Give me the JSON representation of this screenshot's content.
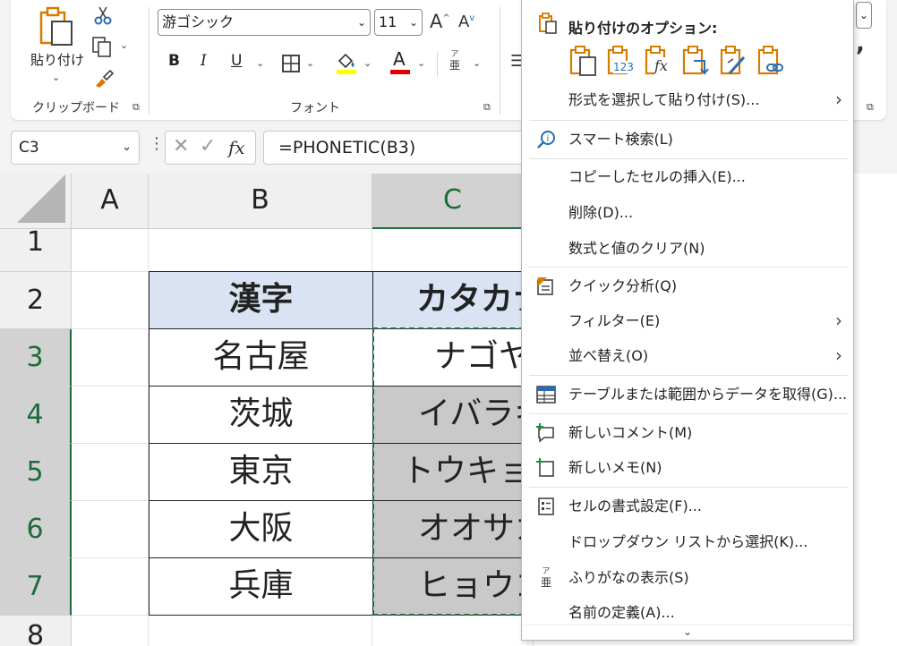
{
  "ribbon": {
    "clipboard": {
      "paste_label": "貼り付け",
      "group_label": "クリップボード"
    },
    "font": {
      "font_name": "游ゴシック",
      "font_size": "11",
      "grow_label": "A",
      "shrink_label": "A",
      "bold": "B",
      "italic": "I",
      "underline": "U",
      "font_color_glyph": "A",
      "phonetic_glyph_top": "ア",
      "phonetic_glyph_bottom": "亜",
      "group_label": "フォント"
    },
    "highlight_color": "#ffff00",
    "font_color": "#e00000"
  },
  "formula_bar": {
    "name_box": "C3",
    "cancel_glyph": "✕",
    "enter_glyph": "✓",
    "fx_glyph": "fx",
    "formula": "=PHONETIC(B3)"
  },
  "grid": {
    "columns": [
      "A",
      "B",
      "C"
    ],
    "rows": [
      "1",
      "2",
      "3",
      "4",
      "5",
      "6",
      "7",
      "8"
    ],
    "table": {
      "header": [
        "漢字",
        "カタカナ"
      ],
      "rows": [
        [
          "名古屋",
          "ナゴヤ"
        ],
        [
          "茨城",
          "イバラキ"
        ],
        [
          "東京",
          "トウキョウ"
        ],
        [
          "大阪",
          "オオサカ"
        ],
        [
          "兵庫",
          "ヒョウゴ"
        ]
      ]
    },
    "header_fill": "#dae3f3",
    "selection_color": "#1e6b3a"
  },
  "context_menu": {
    "paste_options_title": "貼り付けのオプション:",
    "paste_icon_labels": [
      "123",
      "fx"
    ],
    "items": [
      {
        "label": "形式を選択して貼り付け(S)...",
        "submenu": true
      },
      {
        "label": "スマート検索(L)",
        "submenu": false
      },
      {
        "label": "コピーしたセルの挿入(E)...",
        "submenu": false
      },
      {
        "label": "削除(D)...",
        "submenu": false
      },
      {
        "label": "数式と値のクリア(N)",
        "submenu": false
      },
      {
        "label": "クイック分析(Q)",
        "submenu": false
      },
      {
        "label": "フィルター(E)",
        "submenu": true
      },
      {
        "label": "並べ替え(O)",
        "submenu": true
      },
      {
        "label": "テーブルまたは範囲からデータを取得(G)...",
        "submenu": false
      },
      {
        "label": "新しいコメント(M)",
        "submenu": false
      },
      {
        "label": "新しいメモ(N)",
        "submenu": false
      },
      {
        "label": "セルの書式設定(F)...",
        "submenu": false
      },
      {
        "label": "ドロップダウン リストから選択(K)...",
        "submenu": false
      },
      {
        "label": "ふりがなの表示(S)",
        "submenu": false
      },
      {
        "label": "名前の定義(A)...",
        "submenu": false
      }
    ],
    "phonetic_icon_top": "ア",
    "phonetic_icon_bottom": "亜"
  },
  "icons": {
    "paste": "paste-icon",
    "cut": "scissors-icon",
    "copy": "copy-icon",
    "format_painter": "brush-icon",
    "borders": "borders-icon",
    "fill_color": "fill-color-icon",
    "font_color": "font-color-icon",
    "smart_lookup": "info-search-icon",
    "quick_analysis": "quick-analysis-icon",
    "table": "table-icon",
    "comment": "new-comment-icon",
    "note": "new-note-icon",
    "format_cells": "format-cells-icon",
    "accent": "#d77b00",
    "icon_blue": "#2b6cb0"
  }
}
